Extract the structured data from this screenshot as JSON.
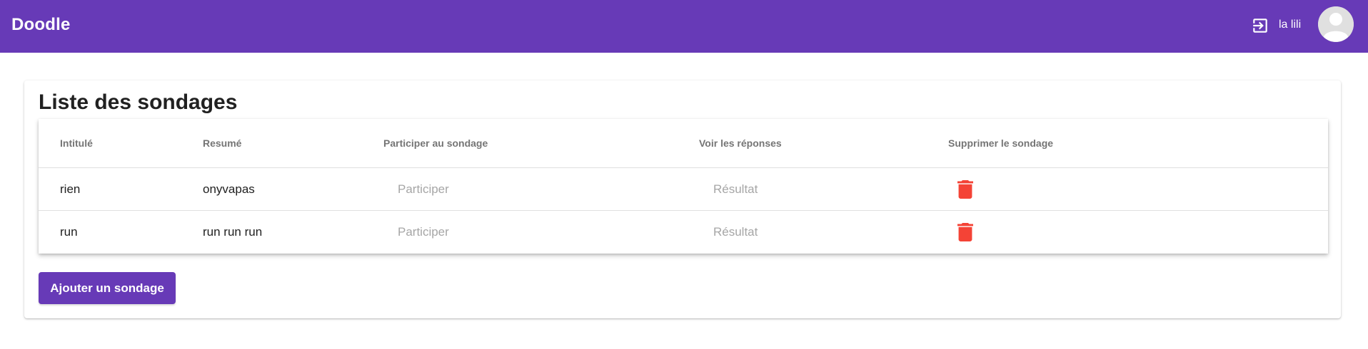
{
  "toolbar": {
    "title": "Doodle",
    "user_name": "la lili",
    "login_icon": "login-icon",
    "avatar_icon": "account-circle-icon",
    "background_color": "#673ab7"
  },
  "card": {
    "title": "Liste des sondages"
  },
  "table": {
    "headers": [
      "Intitulé",
      "Resumé",
      "Participer au sondage",
      "Voir les réponses",
      "Supprimer le sondage"
    ],
    "rows": [
      {
        "intitule": "rien",
        "resume": "onyvapas",
        "participer": "Participer",
        "resultat": "Résultat",
        "delete_icon": "delete-icon"
      },
      {
        "intitule": "run",
        "resume": "run run run",
        "participer": "Participer",
        "resultat": "Résultat",
        "delete_icon": "delete-icon"
      }
    ]
  },
  "actions": {
    "add_label": "Ajouter un sondage"
  },
  "colors": {
    "primary": "#673ab7",
    "delete": "#f44336",
    "link_disabled": "#a6a6a6"
  }
}
